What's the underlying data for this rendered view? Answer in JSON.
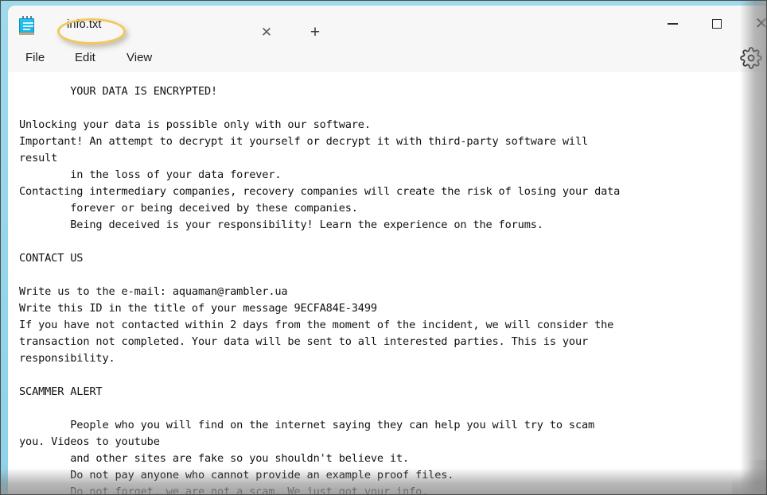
{
  "window": {
    "app_icon_name": "notepad-icon",
    "tab_label": "info.txt",
    "tab_close_glyph": "✕",
    "new_tab_glyph": "+",
    "annotation_color": "#F2C75C",
    "caption": {
      "minimize_label": "—",
      "maximize_label": "□",
      "close_label": "✕"
    }
  },
  "menu": {
    "items": [
      {
        "label": "File"
      },
      {
        "label": "Edit"
      },
      {
        "label": "View"
      }
    ],
    "settings_icon": "gear-icon"
  },
  "editor": {
    "content": "        YOUR DATA IS ENCRYPTED!\n\nUnlocking your data is possible only with our software.\nImportant! An attempt to decrypt it yourself or decrypt it with third-party software will\nresult\n        in the loss of your data forever.\nContacting intermediary companies, recovery companies will create the risk of losing your data\n        forever or being deceived by these companies.\n        Being deceived is your responsibility! Learn the experience on the forums.\n\nCONTACT US\n\nWrite us to the e-mail: aquaman@rambler.ua\nWrite this ID in the title of your message 9ECFA84E-3499\nIf you have not contacted within 2 days from the moment of the incident, we will consider the\ntransaction not completed. Your data will be sent to all interested parties. This is your\nresponsibility.\n\nSCAMMER ALERT\n\n        People who you will find on the internet saying they can help you will try to scam\nyou. Videos to youtube\n        and other sites are fake so you shouldn't believe it.\n        Do not pay anyone who cannot provide an example proof files.\n        Do not forget, we are not a scam. We just got your info.",
    "email": "aquaman@rambler.ua",
    "victim_id": "9ECFA84E-3499",
    "headings": [
      "YOUR DATA IS ENCRYPTED!",
      "CONTACT US",
      "SCAMMER ALERT"
    ]
  }
}
